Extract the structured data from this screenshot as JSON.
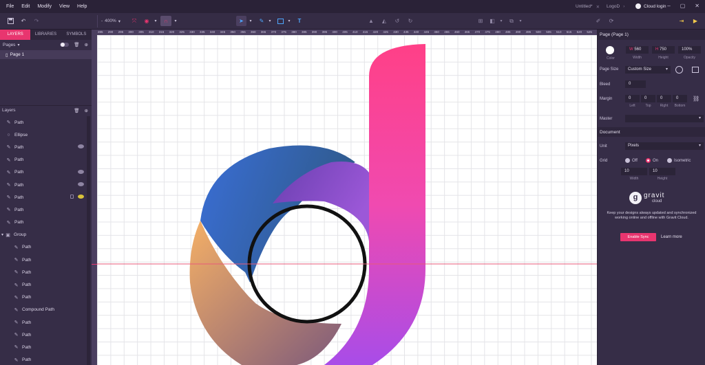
{
  "menu": [
    "File",
    "Edit",
    "Modify",
    "View",
    "Help"
  ],
  "doc_tabs": [
    {
      "label": "Untitled*"
    },
    {
      "label": "LogoD"
    }
  ],
  "cloud_login": "Cloud login",
  "toolbar": {
    "zoom": "400%"
  },
  "left_tabs": [
    "LAYERS",
    "LIBRARIES",
    "SYMBOLS"
  ],
  "pages": {
    "title": "Pages",
    "items": [
      "Page 1"
    ]
  },
  "layers": {
    "title": "Layers",
    "items": [
      {
        "label": "Path",
        "icon": "pen-icon",
        "depth": 0,
        "state": ""
      },
      {
        "label": "Ellipse",
        "icon": "ellipse-icon",
        "depth": 0,
        "state": ""
      },
      {
        "label": "Path",
        "icon": "pen-icon",
        "depth": 0,
        "state": "hidden"
      },
      {
        "label": "Path",
        "icon": "pen-icon",
        "depth": 0,
        "state": ""
      },
      {
        "label": "Path",
        "icon": "pen-icon",
        "depth": 0,
        "state": "hidden"
      },
      {
        "label": "Path",
        "icon": "pen-icon",
        "depth": 0,
        "state": "hidden"
      },
      {
        "label": "Path",
        "icon": "pen-icon",
        "depth": 0,
        "state": "hover"
      },
      {
        "label": "Path",
        "icon": "pen-icon",
        "depth": 0,
        "state": ""
      },
      {
        "label": "Path",
        "icon": "pen-icon",
        "depth": 0,
        "state": ""
      },
      {
        "label": "Group",
        "icon": "group-icon",
        "depth": 0,
        "state": "expanded"
      },
      {
        "label": "Path",
        "icon": "pen-icon",
        "depth": 1,
        "state": ""
      },
      {
        "label": "Path",
        "icon": "pen-icon",
        "depth": 1,
        "state": ""
      },
      {
        "label": "Path",
        "icon": "pen-icon",
        "depth": 1,
        "state": ""
      },
      {
        "label": "Path",
        "icon": "pen-icon",
        "depth": 1,
        "state": ""
      },
      {
        "label": "Path",
        "icon": "pen-icon",
        "depth": 1,
        "state": ""
      },
      {
        "label": "Compound Path",
        "icon": "pen-icon",
        "depth": 1,
        "state": ""
      },
      {
        "label": "Path",
        "icon": "pen-icon",
        "depth": 1,
        "state": ""
      },
      {
        "label": "Path",
        "icon": "pen-icon",
        "depth": 1,
        "state": ""
      },
      {
        "label": "Path",
        "icon": "pen-icon",
        "depth": 1,
        "state": ""
      },
      {
        "label": "Path",
        "icon": "pen-icon",
        "depth": 1,
        "state": ""
      }
    ]
  },
  "ruler_ticks": [
    "285",
    "290",
    "295",
    "300",
    "305",
    "310",
    "315",
    "320",
    "325",
    "330",
    "335",
    "340",
    "345",
    "350",
    "355",
    "360",
    "365",
    "370",
    "375",
    "380",
    "385",
    "390",
    "395",
    "400",
    "405",
    "410",
    "415",
    "420",
    "425",
    "430",
    "435",
    "440",
    "445",
    "450",
    "455",
    "460",
    "465",
    "470",
    "475",
    "480",
    "485",
    "490",
    "495",
    "500",
    "505",
    "510",
    "515",
    "520",
    "525"
  ],
  "inspector": {
    "title": "Page (Page 1)",
    "color_label": "Color",
    "width_label": "Width",
    "width": "560",
    "height_label": "Height",
    "height": "750",
    "opacity_label": "Opacity",
    "opacity": "100%",
    "page_size_label": "Page Size",
    "page_size": "Custom Size",
    "bleed_label": "Bleed",
    "bleed": "0",
    "margin_label": "Margin",
    "margins": [
      {
        "label": "Left",
        "value": "0"
      },
      {
        "label": "Top",
        "value": "0"
      },
      {
        "label": "Right",
        "value": "0"
      },
      {
        "label": "Bottom",
        "value": "0"
      }
    ],
    "master_label": "Master",
    "document_title": "Document",
    "unit_label": "Unit",
    "unit": "Pixels",
    "grid_label": "Grid",
    "grid_options": [
      "Off",
      "On",
      "Isometric"
    ],
    "grid_selected": "On",
    "grid_width": "10",
    "grid_height": "10",
    "grid_width_label": "Width",
    "grid_height_label": "Height",
    "brand_name": "gravit",
    "brand_sub": "cloud",
    "cloud_text": "Keep your designs always updated and synchronized working online and offline with Gravit Cloud.",
    "enable_sync": "Enable Sync",
    "learn_more": "Learn more"
  },
  "colors": {
    "accent": "#e8356f",
    "panel": "#362d47",
    "canvas": "#ffffff"
  }
}
